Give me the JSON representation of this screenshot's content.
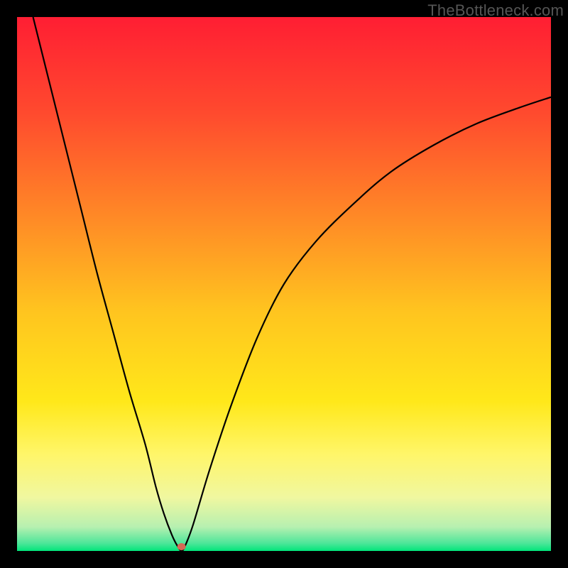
{
  "watermark": "TheBottleneck.com",
  "chart_data": {
    "type": "line",
    "title": "",
    "xlabel": "",
    "ylabel": "",
    "xlim": [
      0,
      100
    ],
    "ylim": [
      0,
      100
    ],
    "background_gradient": {
      "stops": [
        {
          "offset": 0.0,
          "color": "#ff1e33"
        },
        {
          "offset": 0.18,
          "color": "#ff4a2e"
        },
        {
          "offset": 0.38,
          "color": "#ff8b26"
        },
        {
          "offset": 0.55,
          "color": "#ffc41f"
        },
        {
          "offset": 0.72,
          "color": "#ffe81a"
        },
        {
          "offset": 0.82,
          "color": "#fff66a"
        },
        {
          "offset": 0.9,
          "color": "#f0f7a0"
        },
        {
          "offset": 0.955,
          "color": "#b7f0b0"
        },
        {
          "offset": 0.985,
          "color": "#4fe69a"
        },
        {
          "offset": 1.0,
          "color": "#00e57a"
        }
      ]
    },
    "series": [
      {
        "name": "bottleneck-curve",
        "color": "#000000",
        "x": [
          3,
          6,
          9,
          12,
          15,
          18,
          21,
          24,
          26,
          27.5,
          29,
          30,
          30.8,
          31.5,
          33,
          36,
          40,
          45,
          50,
          56,
          63,
          70,
          78,
          86,
          94,
          100
        ],
        "y": [
          100,
          88,
          76,
          64,
          52,
          41,
          30,
          20,
          12,
          7,
          3,
          1,
          0,
          1,
          5,
          15,
          27,
          40,
          50,
          58,
          65,
          71,
          76,
          80,
          83,
          85
        ]
      }
    ],
    "marker": {
      "name": "optimal-point",
      "x": 30.8,
      "y": 0.8,
      "color": "#d46a55",
      "rxy": [
        6,
        5
      ]
    },
    "grid": false,
    "legend": false
  }
}
